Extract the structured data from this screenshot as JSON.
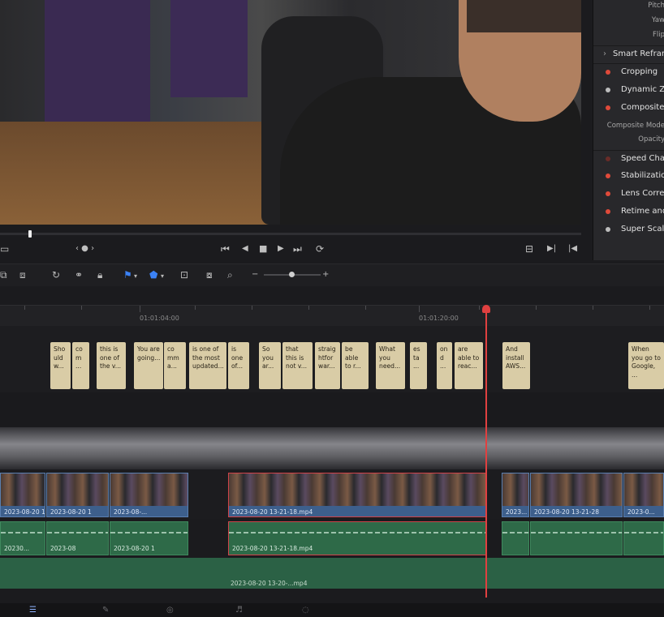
{
  "inspector": {
    "top_labels": [
      "Pitch",
      "Yaw",
      "Flip"
    ],
    "smart_reframe": "Smart Reframe",
    "items": [
      {
        "label": "Cropping",
        "dot": "red"
      },
      {
        "label": "Dynamic Zoom",
        "dot": "grey"
      },
      {
        "label": "Composite",
        "dot": "red"
      },
      {
        "label": "Speed Change",
        "dot": "dim"
      },
      {
        "label": "Stabilization",
        "dot": "red"
      },
      {
        "label": "Lens Correction",
        "dot": "red"
      },
      {
        "label": "Retime and Scaling",
        "dot": "red"
      },
      {
        "label": "Super Scale",
        "dot": "grey"
      }
    ],
    "composite_sub": [
      "Composite Mode",
      "Opacity"
    ]
  },
  "transport": {
    "nav": "‹ ● ›",
    "buttons": [
      "⏮",
      "◀",
      "■",
      "▶",
      "⏭",
      "⟳"
    ],
    "right_buttons": [
      "⊟",
      "▶|",
      "|◀"
    ]
  },
  "ruler": {
    "timecodes": [
      "01:01:04:00",
      "01:01:20:00"
    ]
  },
  "subtitles": [
    "Sho uld w...",
    "co m ...",
    "this is one of the v...",
    "You are going...",
    "co mm a...",
    "is one of the most updated...",
    "is one of...",
    "So you ar...",
    "that this is not v...",
    "straig htfor war...",
    "be able to r...",
    "What you need...",
    "es ta ...",
    "on d ...",
    "are able to reac...",
    "And install AWS...",
    "When you go to Google, ..."
  ],
  "video_clips": [
    "2023-08-20 1",
    "2023-08-20 1",
    "2023-08-...",
    "2023-08-20 13-21-18.mp4",
    "2023...",
    "2023-08-20 13-21-28",
    "2023-0..."
  ],
  "audio_clips": [
    "20230...",
    "2023-08",
    "2023-08-20 1",
    "2023-08-20 13-21-18.mp4",
    "",
    "",
    ""
  ],
  "audio2_clip": "2023-08-20 13-20-...mp4",
  "colors": {
    "playhead": "#e04040",
    "subtitle_clip": "#d9cca6",
    "video_clip": "#3d5f8c",
    "audio_clip": "#2e6a48",
    "keyframe_dot_active": "#e04a3a"
  }
}
